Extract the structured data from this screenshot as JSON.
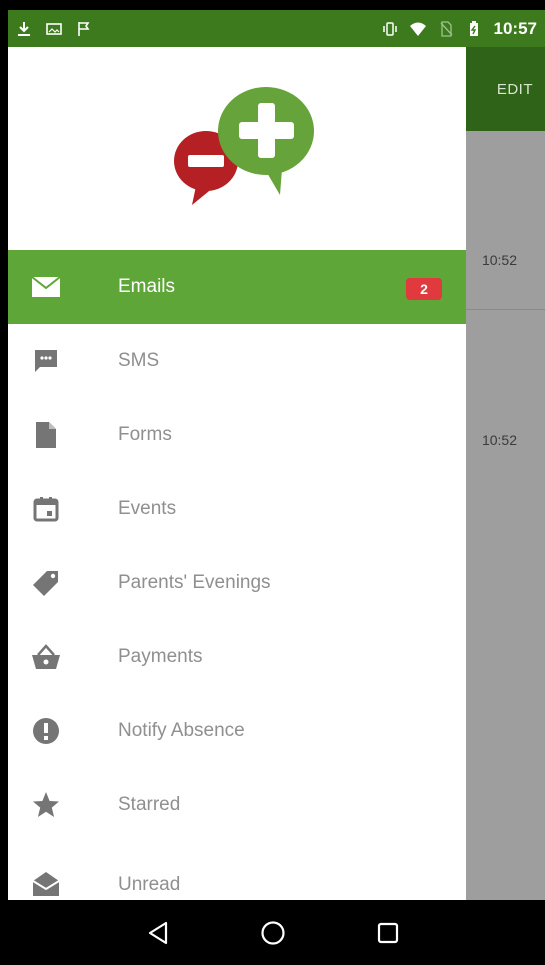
{
  "status_bar": {
    "time": "10:57",
    "left_icons": [
      "download-icon",
      "image-icon",
      "flag-icon"
    ],
    "right_icons": [
      "vibrate-icon",
      "wifi-icon",
      "no-sim-icon",
      "battery-icon"
    ]
  },
  "app": {
    "toolbar_action": "EDIT",
    "times": [
      "10:52",
      "10:52"
    ]
  },
  "drawer": {
    "items": [
      {
        "label": "Emails",
        "icon": "mail-icon",
        "badge": "2",
        "active": true
      },
      {
        "label": "SMS",
        "icon": "sms-icon"
      },
      {
        "label": "Forms",
        "icon": "document-icon"
      },
      {
        "label": "Events",
        "icon": "calendar-icon"
      },
      {
        "label": "Parents' Evenings",
        "icon": "tag-icon"
      },
      {
        "label": "Payments",
        "icon": "basket-icon"
      },
      {
        "label": "Notify Absence",
        "icon": "alert-icon"
      },
      {
        "label": "Starred",
        "icon": "star-icon"
      },
      {
        "label": "Unread",
        "icon": "open-mail-icon"
      }
    ]
  },
  "nav": [
    "back-icon",
    "home-icon",
    "recents-icon"
  ],
  "colors": {
    "status_bar": "#3d7a1e",
    "toolbar": "#2f6317",
    "active_item": "#5ea638",
    "badge": "#e0393e",
    "icon_gray": "#757575",
    "label_gray": "#8f8f8f"
  }
}
